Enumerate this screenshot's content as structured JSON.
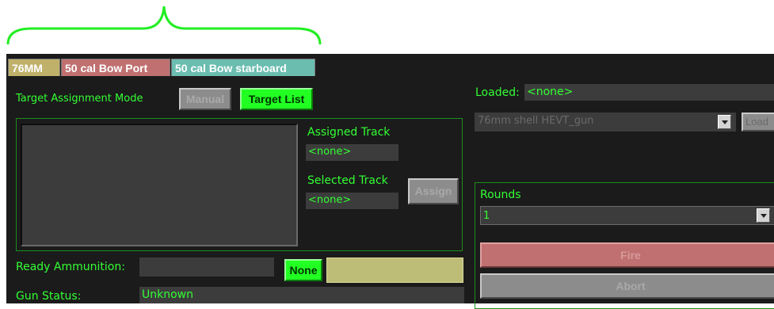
{
  "tabs": [
    {
      "label": "76MM",
      "color": "#bfb06a",
      "active": true
    },
    {
      "label": "50 cal Bow Port",
      "color": "#c07070"
    },
    {
      "label": "50 cal Bow starboard",
      "color": "#6bbdb0"
    }
  ],
  "target_assignment": {
    "label": "Target Assignment Mode",
    "manual_label": "Manual",
    "target_list_label": "Target List"
  },
  "tracks": {
    "assigned_label": "Assigned Track",
    "assigned_value": "<none>",
    "selected_label": "Selected Track",
    "selected_value": "<none>",
    "assign_label": "Assign"
  },
  "ammo": {
    "ready_label": "Ready Ammunition:",
    "ready_value": "",
    "none_label": "None"
  },
  "gun_status": {
    "label": "Gun Status:",
    "value": "Unknown"
  },
  "loaded": {
    "label": "Loaded:",
    "value": "<none>"
  },
  "shell": {
    "selected": "76mm shell HEVT_gun",
    "load_label": "Load"
  },
  "rounds": {
    "label": "Rounds",
    "selected": "1"
  },
  "fire_label": "Fire",
  "abort_label": "Abort",
  "colors": {
    "label_green": "#33ff33",
    "fire_button": "#c07070",
    "abort_button": "#8c8c8c",
    "ammo_box": "#bdbd78",
    "brace": "#22ee22"
  }
}
